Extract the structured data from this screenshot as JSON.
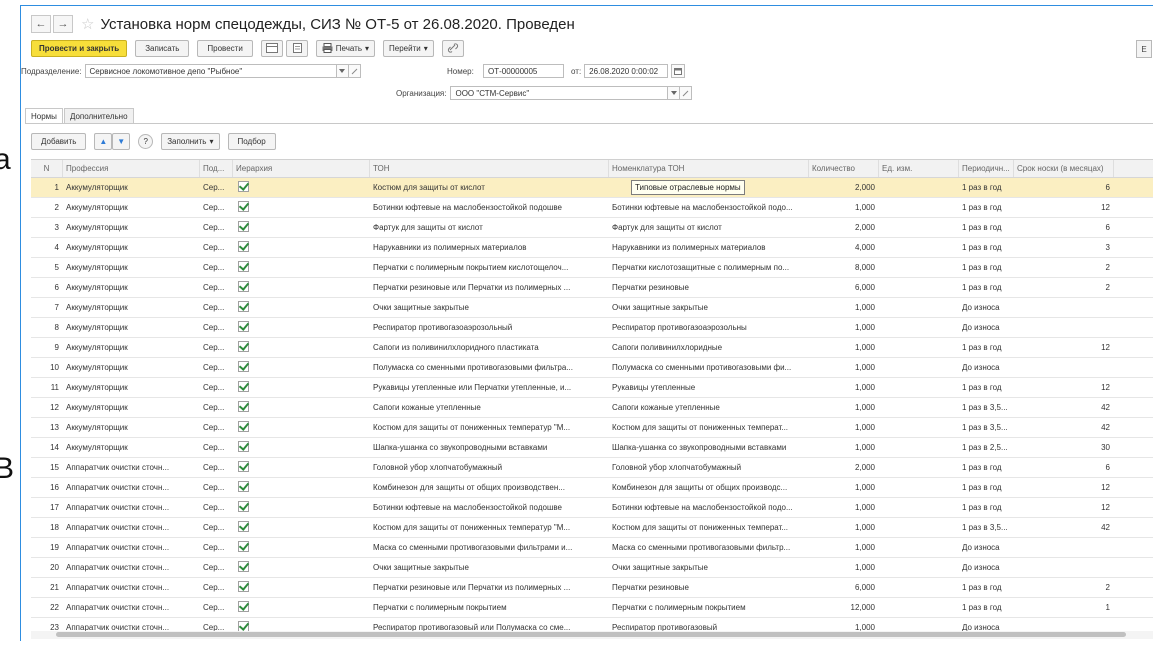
{
  "side_letters": [
    "а",
    "В"
  ],
  "window": {
    "title": "Установка норм спецодежды, СИЗ № ОТ-5 от 26.08.2020. Проведен"
  },
  "nav": {
    "back_icon": "←",
    "forward_icon": "→",
    "star_icon": "☆"
  },
  "toolbar": {
    "post_close": "Провести и закрыть",
    "save": "Записать",
    "post": "Провести",
    "print": "Печать",
    "goto": "Перейти",
    "dropdown_mark": "▾",
    "clip_icon": "🔗",
    "edge": "E"
  },
  "form": {
    "division_label": "Подразделение:",
    "division_value": "Сервисное локомотивное депо \"Рыбное\"",
    "number_label": "Номер:",
    "number_value": "ОТ-00000005",
    "date_label": "от:",
    "date_value": "26.08.2020  0:00:02",
    "org_label": "Организация:",
    "org_value": "ООО \"СТМ-Сервис\""
  },
  "tabs": [
    {
      "label": "Нормы"
    },
    {
      "label": "Дополнительно"
    }
  ],
  "grid_toolbar": {
    "add": "Добавить",
    "fill": "Заполнить",
    "pick": "Подбор",
    "up_icon": "▲",
    "down_icon": "▼",
    "help_icon": "?"
  },
  "columns": [
    "N",
    "Профессия",
    "Под...",
    "Иерархия",
    "ТОН",
    "Номенклатура ТОН",
    "Количество",
    "Ед. изм.",
    "Периодичн...",
    "Срок носки (в месяцах)"
  ],
  "tooltip": "Типовые отраслевые нормы",
  "rows": [
    {
      "n": "1",
      "prof": "Аккумуляторщик",
      "pod": "Сер...",
      "ton": "Костюм для защиты от кислот",
      "nom": "",
      "qty": "2,000",
      "per": "1 раз в год",
      "term": "6"
    },
    {
      "n": "2",
      "prof": "Аккумуляторщик",
      "pod": "Сер...",
      "ton": "Ботинки юфтевые на маслобензостойкой подошве",
      "nom": "Ботинки юфтевые на маслобензостойкой подо...",
      "qty": "1,000",
      "per": "1 раз в год",
      "term": "12"
    },
    {
      "n": "3",
      "prof": "Аккумуляторщик",
      "pod": "Сер...",
      "ton": "Фартук для защиты от кислот",
      "nom": "Фартук для защиты от кислот",
      "qty": "2,000",
      "per": "1 раз в год",
      "term": "6"
    },
    {
      "n": "4",
      "prof": "Аккумуляторщик",
      "pod": "Сер...",
      "ton": "Нарукавники из полимерных материалов",
      "nom": "Нарукавники из полимерных материалов",
      "qty": "4,000",
      "per": "1 раз в год",
      "term": "3"
    },
    {
      "n": "5",
      "prof": "Аккумуляторщик",
      "pod": "Сер...",
      "ton": "Перчатки с полимерным покрытием кислотощелоч...",
      "nom": "Перчатки кислотозащитные с полимерным по...",
      "qty": "8,000",
      "per": "1 раз в год",
      "term": "2"
    },
    {
      "n": "6",
      "prof": "Аккумуляторщик",
      "pod": "Сер...",
      "ton": "Перчатки резиновые или Перчатки из полимерных ...",
      "nom": "Перчатки резиновые",
      "qty": "6,000",
      "per": "1 раз в год",
      "term": "2"
    },
    {
      "n": "7",
      "prof": "Аккумуляторщик",
      "pod": "Сер...",
      "ton": "Очки защитные закрытые",
      "nom": "Очки защитные закрытые",
      "qty": "1,000",
      "per": "До износа",
      "term": ""
    },
    {
      "n": "8",
      "prof": "Аккумуляторщик",
      "pod": "Сер...",
      "ton": "Респиратор противогазоаэрозольный",
      "nom": "Респиратор противогазоаэрозольны",
      "qty": "1,000",
      "per": "До износа",
      "term": ""
    },
    {
      "n": "9",
      "prof": "Аккумуляторщик",
      "pod": "Сер...",
      "ton": "Сапоги из поливинилхлоридного пластиката",
      "nom": "Сапоги поливинилхлоридные",
      "qty": "1,000",
      "per": "1 раз в год",
      "term": "12"
    },
    {
      "n": "10",
      "prof": "Аккумуляторщик",
      "pod": "Сер...",
      "ton": "Полумаска со сменными противогазовыми фильтра...",
      "nom": "Полумаска со сменными противогазовыми фи...",
      "qty": "1,000",
      "per": "До износа",
      "term": ""
    },
    {
      "n": "11",
      "prof": "Аккумуляторщик",
      "pod": "Сер...",
      "ton": "Рукавицы утепленные или Перчатки утепленные, и...",
      "nom": "Рукавицы утепленные",
      "qty": "1,000",
      "per": "1 раз в год",
      "term": "12"
    },
    {
      "n": "12",
      "prof": "Аккумуляторщик",
      "pod": "Сер...",
      "ton": "Сапоги кожаные утепленные",
      "nom": "Сапоги кожаные утепленные",
      "qty": "1,000",
      "per": "1 раз в 3,5...",
      "term": "42"
    },
    {
      "n": "13",
      "prof": "Аккумуляторщик",
      "pod": "Сер...",
      "ton": "Костюм для защиты от пониженных температур \"М...",
      "nom": "Костюм для защиты от пониженных температ...",
      "qty": "1,000",
      "per": "1 раз в 3,5...",
      "term": "42"
    },
    {
      "n": "14",
      "prof": "Аккумуляторщик",
      "pod": "Сер...",
      "ton": "Шапка-ушанка со звукопроводными вставками",
      "nom": "Шапка-ушанка со звукопроводными вставками",
      "qty": "1,000",
      "per": "1 раз в 2,5...",
      "term": "30"
    },
    {
      "n": "15",
      "prof": "Аппаратчик очистки сточн...",
      "pod": "Сер...",
      "ton": "Головной убор хлопчатобумажный",
      "nom": "Головной убор хлопчатобумажный",
      "qty": "2,000",
      "per": "1 раз в год",
      "term": "6"
    },
    {
      "n": "16",
      "prof": "Аппаратчик очистки сточн...",
      "pod": "Сер...",
      "ton": "Комбинезон для защиты от общих производствен...",
      "nom": "Комбинезон для защиты от общих производс...",
      "qty": "1,000",
      "per": "1 раз в год",
      "term": "12"
    },
    {
      "n": "17",
      "prof": "Аппаратчик очистки сточн...",
      "pod": "Сер...",
      "ton": "Ботинки юфтевые на маслобензостойкой подошве",
      "nom": "Ботинки юфтевые на маслобензостойкой подо...",
      "qty": "1,000",
      "per": "1 раз в год",
      "term": "12"
    },
    {
      "n": "18",
      "prof": "Аппаратчик очистки сточн...",
      "pod": "Сер...",
      "ton": "Костюм для защиты от пониженных температур \"М...",
      "nom": "Костюм для защиты от пониженных температ...",
      "qty": "1,000",
      "per": "1 раз в 3,5...",
      "term": "42"
    },
    {
      "n": "19",
      "prof": "Аппаратчик очистки сточн...",
      "pod": "Сер...",
      "ton": "Маска со сменными противогазовыми фильтрами и...",
      "nom": "Маска со сменными противогазовыми фильтр...",
      "qty": "1,000",
      "per": "До износа",
      "term": ""
    },
    {
      "n": "20",
      "prof": "Аппаратчик очистки сточн...",
      "pod": "Сер...",
      "ton": "Очки защитные закрытые",
      "nom": "Очки защитные закрытые",
      "qty": "1,000",
      "per": "До износа",
      "term": ""
    },
    {
      "n": "21",
      "prof": "Аппаратчик очистки сточн...",
      "pod": "Сер...",
      "ton": "Перчатки резиновые или Перчатки из полимерных ...",
      "nom": "Перчатки резиновые",
      "qty": "6,000",
      "per": "1 раз в год",
      "term": "2"
    },
    {
      "n": "22",
      "prof": "Аппаратчик очистки сточн...",
      "pod": "Сер...",
      "ton": "Перчатки с полимерным покрытием",
      "nom": "Перчатки с полимерным покрытием",
      "qty": "12,000",
      "per": "1 раз в год",
      "term": "1"
    },
    {
      "n": "23",
      "prof": "Аппаратчик очистки сточн...",
      "pod": "Сер...",
      "ton": "Респиратор противогазовый или Полумаска со сме...",
      "nom": "Респиратор противогазовый",
      "qty": "1,000",
      "per": "До износа",
      "term": ""
    }
  ],
  "colors": {
    "primary_button": "#f7de3a",
    "selected_row": "#fbefc2",
    "frame_border": "#2e8de0",
    "check": "#2e8b3c"
  }
}
